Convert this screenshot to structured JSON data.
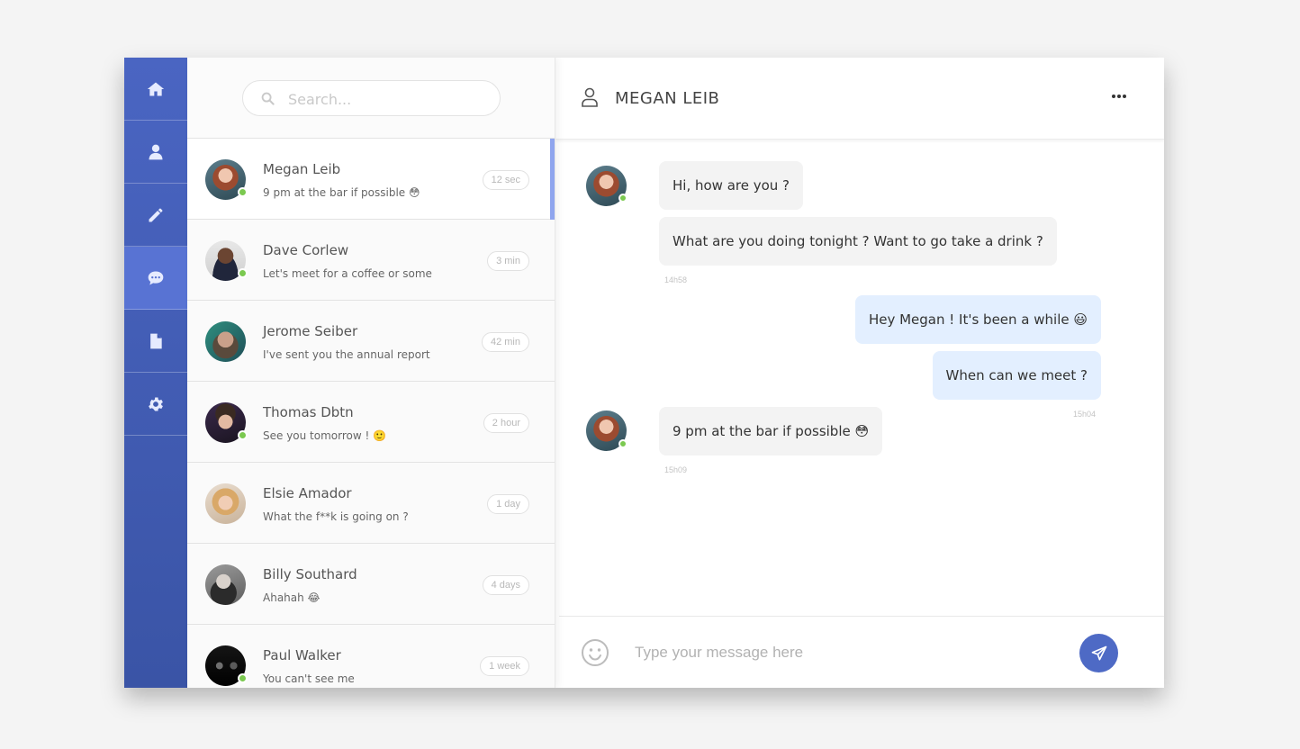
{
  "nav": {
    "items": [
      {
        "icon": "home-icon",
        "active": false
      },
      {
        "icon": "user-icon",
        "active": false
      },
      {
        "icon": "pencil-icon",
        "active": false
      },
      {
        "icon": "chat-icon",
        "active": true
      },
      {
        "icon": "file-icon",
        "active": false
      },
      {
        "icon": "gear-icon",
        "active": false
      }
    ]
  },
  "search": {
    "placeholder": "Search..."
  },
  "conversations": [
    {
      "name": "Megan Leib",
      "preview": "9 pm at the bar if possible 😳",
      "time": "12 sec",
      "online": true
    },
    {
      "name": "Dave Corlew",
      "preview": "Let's meet for a coffee or some",
      "time": "3 min",
      "online": true
    },
    {
      "name": "Jerome Seiber",
      "preview": "I've sent you the annual report",
      "time": "42 min",
      "online": false
    },
    {
      "name": "Thomas Dbtn",
      "preview": "See you tomorrow ! 🙂",
      "time": "2 hour",
      "online": true
    },
    {
      "name": "Elsie Amador",
      "preview": "What the f**k is going on ?",
      "time": "1 day",
      "online": false
    },
    {
      "name": "Billy Southard",
      "preview": "Ahahah 😂",
      "time": "4 days",
      "online": false
    },
    {
      "name": "Paul Walker",
      "preview": "You can't see me",
      "time": "1 week",
      "online": true
    }
  ],
  "chat": {
    "title": "MEGAN LEIB",
    "messages": [
      {
        "text": "Hi, how are you ?",
        "direction": "in"
      },
      {
        "text": "What are you doing tonight ? Want to go take a drink ?",
        "direction": "in"
      },
      {
        "text": "Hey Megan ! It's been a while 😃",
        "direction": "out"
      },
      {
        "text": "When can we meet ?",
        "direction": "out"
      },
      {
        "text": "9 pm at the bar if possible 😳",
        "direction": "in"
      }
    ],
    "times": [
      "14h58",
      "15h04",
      "15h09"
    ]
  },
  "composer": {
    "placeholder": "Type your message here"
  },
  "colors": {
    "accent": "#4e6ac5",
    "online": "#7bc950"
  }
}
